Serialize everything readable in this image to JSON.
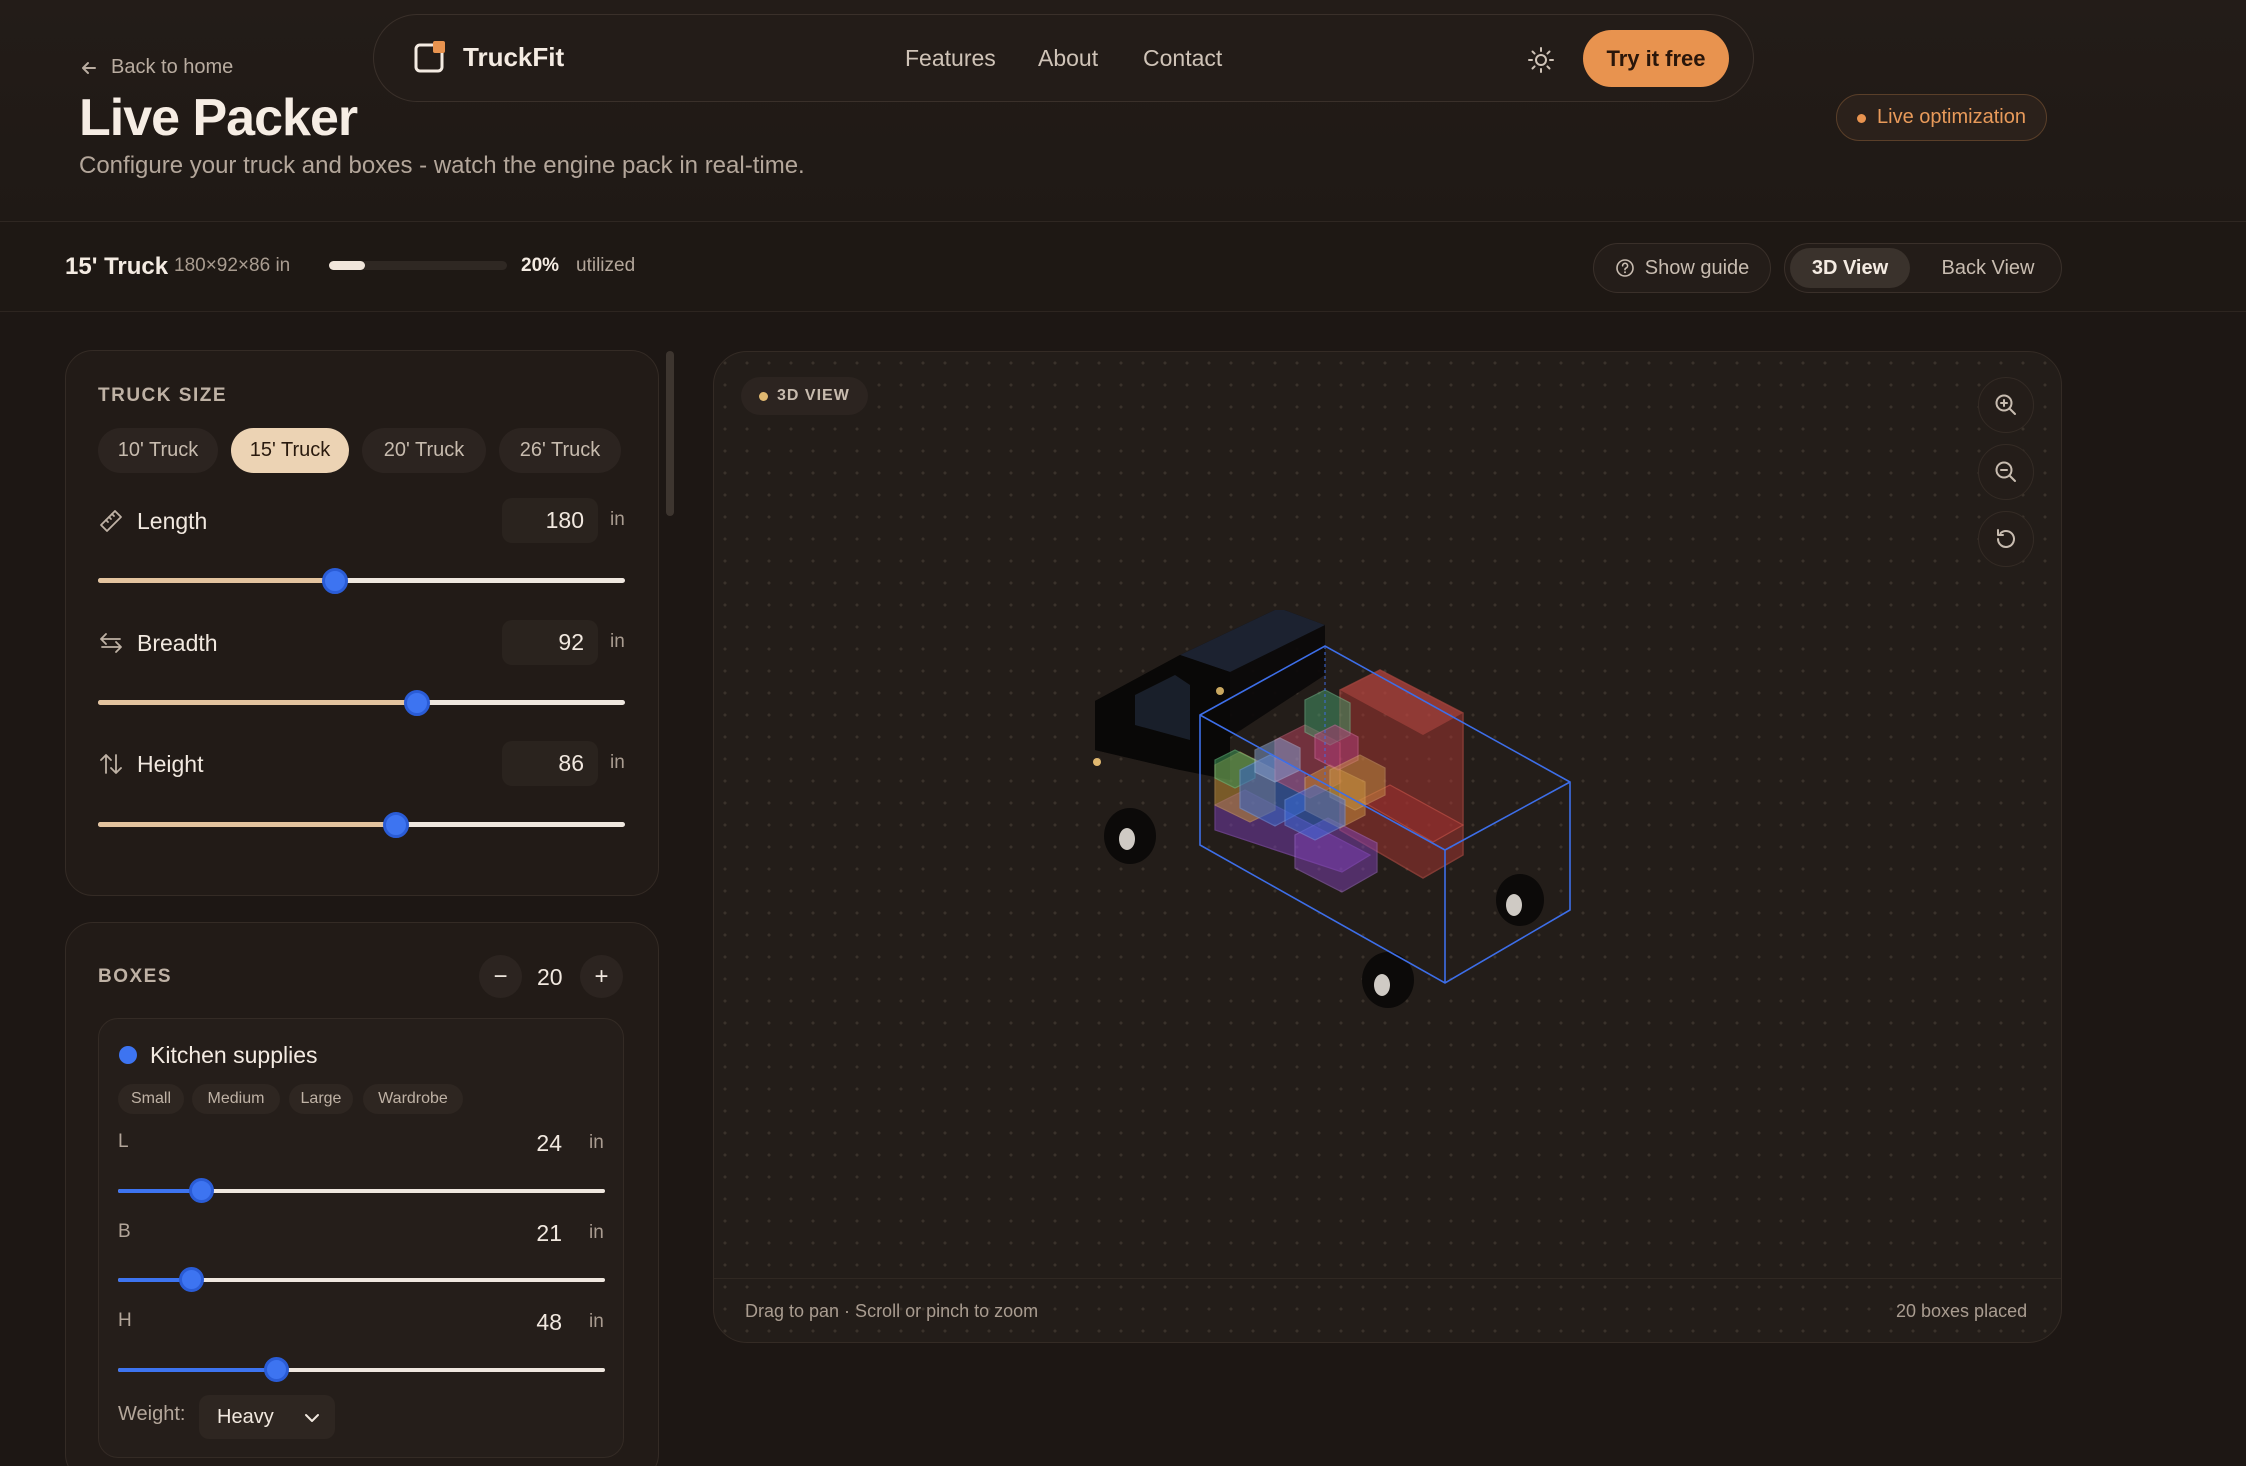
{
  "header": {
    "back_label": "Back to home",
    "title": "Live Packer",
    "subtitle": "Configure your truck and boxes - watch the engine pack in real-time."
  },
  "nav": {
    "brand": "TruckFit",
    "links": [
      "Features",
      "About",
      "Contact"
    ],
    "cta": "Try it free",
    "theme_icon": "sun-icon"
  },
  "live_badge": "Live optimization",
  "status": {
    "truck": "15' Truck",
    "dims": "180×92×86 in",
    "utilization": 0.2,
    "util_pct": "20%",
    "util_label": "utilized",
    "guide_label": "Show guide",
    "views": [
      "3D View",
      "Back View"
    ],
    "active_view": "3D View"
  },
  "truck_size": {
    "label": "TRUCK SIZE",
    "presets": [
      "10' Truck",
      "15' Truck",
      "20' Truck",
      "26' Truck"
    ],
    "active_preset": "15' Truck",
    "dims": [
      {
        "label": "Length",
        "value": "180",
        "unit": "in",
        "fraction": 0.45,
        "icon": "ruler-icon"
      },
      {
        "label": "Breadth",
        "value": "92",
        "unit": "in",
        "fraction": 0.605,
        "icon": "swap-horizontal-icon"
      },
      {
        "label": "Height",
        "value": "86",
        "unit": "in",
        "fraction": 0.565,
        "icon": "swap-vertical-icon"
      }
    ]
  },
  "boxes": {
    "label": "BOXES",
    "count": "20",
    "minus": "−",
    "plus": "+",
    "item": {
      "name": "Kitchen supplies",
      "color": "#3d74f1",
      "sizes": [
        "Small",
        "Medium",
        "Large",
        "Wardrobe"
      ],
      "dims": [
        {
          "label": "L",
          "value": "24",
          "unit": "in",
          "fraction": 0.17
        },
        {
          "label": "B",
          "value": "21",
          "unit": "in",
          "fraction": 0.15
        },
        {
          "label": "H",
          "value": "48",
          "unit": "in",
          "fraction": 0.325
        }
      ],
      "weight_label": "Weight:",
      "weight_value": "Heavy"
    }
  },
  "viewport": {
    "badge": "3D VIEW",
    "hint": "Drag to pan · Scroll or pinch to zoom",
    "placed": "20 boxes placed",
    "controls": [
      "zoom-in-icon",
      "zoom-out-icon",
      "reset-icon"
    ]
  },
  "colors": {
    "accent": "#e8934f",
    "slider_thumb": "#3d74f1",
    "active_preset": "#ecd3b4"
  }
}
